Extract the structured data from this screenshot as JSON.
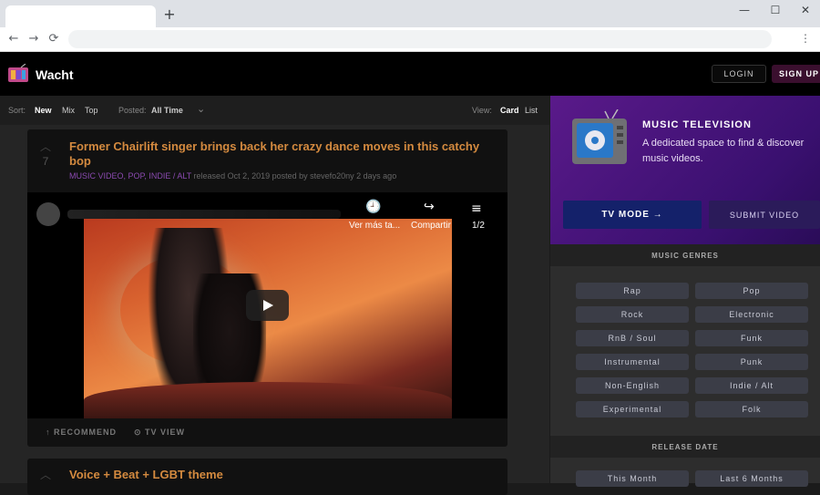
{
  "browser": {
    "new_tab": "+",
    "minimize": "—",
    "maximize": "☐",
    "close": "✕",
    "back": "←",
    "forward": "→",
    "reload": "⟳",
    "menu": "⋮",
    "address": ""
  },
  "site": {
    "brand": "Wacht",
    "login": "LOGIN",
    "signup": "SIGN UP"
  },
  "sortbar": {
    "sort_label": "Sort:",
    "sort_new": "New",
    "sort_mix": "Mix",
    "sort_top": "Top",
    "posted_label": "Posted:",
    "posted_value": "All Time",
    "chevron": "⌄",
    "view_label": "View:",
    "view_card": "Card",
    "view_list": "List"
  },
  "posts": [
    {
      "votes": "7",
      "title": "Former Chairlift singer brings back her crazy dance moves in this catchy bop",
      "tags": "MUSIC VIDEO, POP, INDIE / ALT",
      "meta_rest": " released Oct 2, 2019 posted by stevefo20ny 2 days ago",
      "embed": {
        "watch_later": "Ver más ta...",
        "share": "Compartir",
        "playlist": "1/2"
      },
      "recommend": "RECOMMEND",
      "tv_view": "TV VIEW"
    },
    {
      "title": "Voice + Beat + LGBT theme"
    }
  ],
  "sidebar": {
    "hero_title": "MUSIC TELEVISION",
    "hero_desc": "A dedicated space to find & discover music videos.",
    "tv_mode": "TV MODE →",
    "submit": "SUBMIT VIDEO",
    "genres_title": "MUSIC GENRES",
    "genres": [
      "Rap",
      "Pop",
      "Rock",
      "Electronic",
      "RnB / Soul",
      "Funk",
      "Instrumental",
      "Punk",
      "Non-English",
      "Indie / Alt",
      "Experimental",
      "Folk"
    ],
    "release_title": "RELEASE DATE",
    "release": [
      "This Month",
      "Last 6 Months"
    ]
  },
  "colors": {
    "accent_orange": "#d48a3f",
    "tag_purple": "#8a4ab0",
    "hero_purple": "#5a1a8a"
  }
}
